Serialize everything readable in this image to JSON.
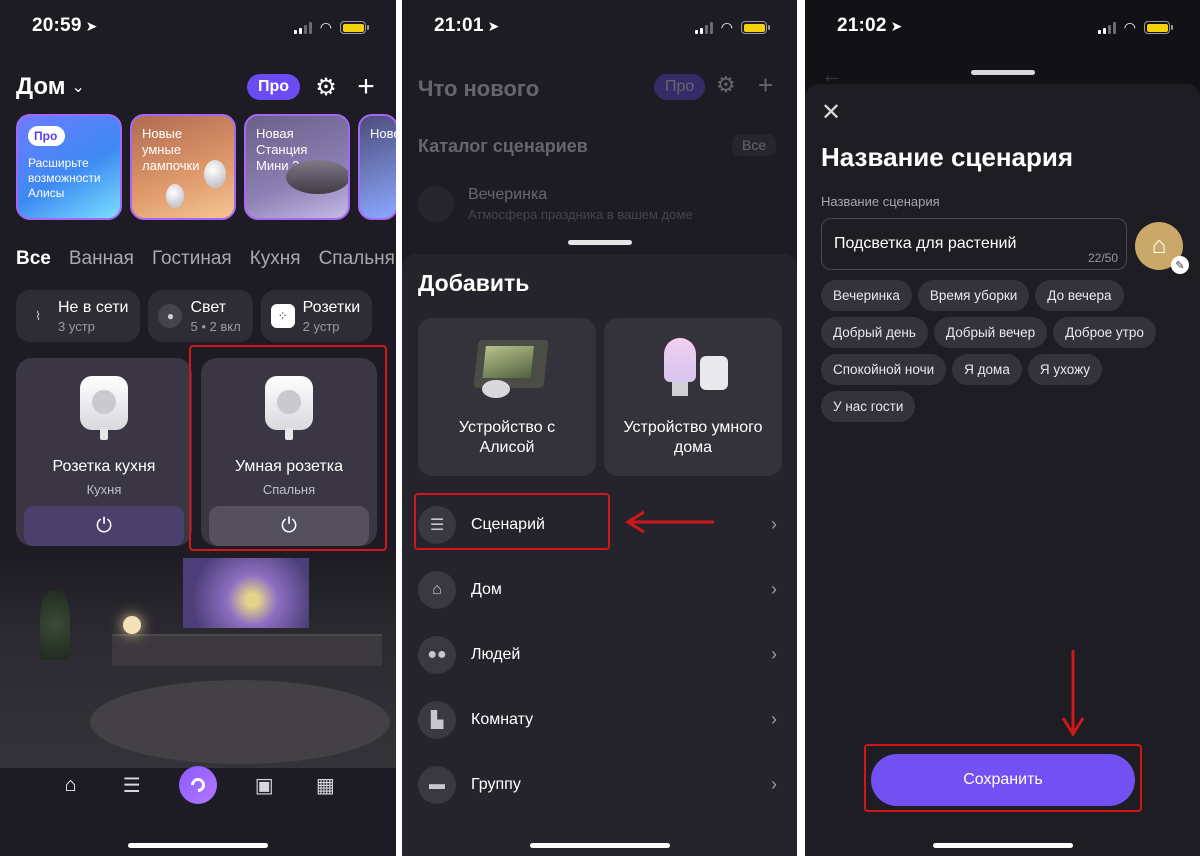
{
  "colors": {
    "accent": "#7350f2",
    "highlight": "#d0181b",
    "battery": "#f5d20b"
  },
  "screen1": {
    "time": "20:59",
    "header": {
      "title": "Дом",
      "pro": "Про",
      "settings_icon": "gear-icon",
      "add_icon": "plus-icon"
    },
    "stories": [
      {
        "badge": "Про",
        "text": "Расширьте возможности Алисы"
      },
      {
        "text": "Новые умные лампочки"
      },
      {
        "text": "Новая Станция Мини 3"
      },
      {
        "text": "Нове в окт"
      }
    ],
    "categories": [
      "Все",
      "Ванная",
      "Гостиная",
      "Кухня",
      "Спальня"
    ],
    "chips": [
      {
        "title": "Не в сети",
        "sub": "3 устр",
        "icon": "wifi-off-icon"
      },
      {
        "title": "Свет",
        "sub": "5 • 2 вкл",
        "icon": "bulb-icon"
      },
      {
        "title": "Розетки",
        "sub": "2 устр",
        "icon": "socket-icon"
      }
    ],
    "devices": [
      {
        "name": "Розетка кухня",
        "room": "Кухня"
      },
      {
        "name": "Умная розетка",
        "room": "Спальня"
      }
    ],
    "tabbar": [
      "home-icon",
      "scenarios-icon",
      "alice-icon",
      "shop-icon",
      "dashboard-icon"
    ]
  },
  "screen2": {
    "time": "21:01",
    "underlay": {
      "title": "Что нового",
      "pro": "Про",
      "catalog": "Каталог сценариев",
      "all": "Все",
      "row_title": "Вечеринка",
      "row_sub": "Атмосфера праздника в вашем доме"
    },
    "sheet_title": "Добавить",
    "tiles": [
      {
        "title": "Устройство с Алисой"
      },
      {
        "title": "Устройство умного дома"
      }
    ],
    "menu": [
      {
        "label": "Сценарий",
        "icon": "scenario-icon"
      },
      {
        "label": "Дом",
        "icon": "home-icon"
      },
      {
        "label": "Людей",
        "icon": "people-icon"
      },
      {
        "label": "Комнату",
        "icon": "room-icon"
      },
      {
        "label": "Группу",
        "icon": "folder-icon"
      }
    ]
  },
  "screen3": {
    "time": "21:02",
    "title": "Название сценария",
    "field_label": "Название сценария",
    "input_value": "Подсветка для растений",
    "counter": "22/50",
    "tags": [
      "Вечеринка",
      "Время уборки",
      "До вечера",
      "Добрый день",
      "Добрый вечер",
      "Доброе утро",
      "Спокойной ночи",
      "Я дома",
      "Я ухожу",
      "У нас гости"
    ],
    "save": "Сохранить"
  }
}
